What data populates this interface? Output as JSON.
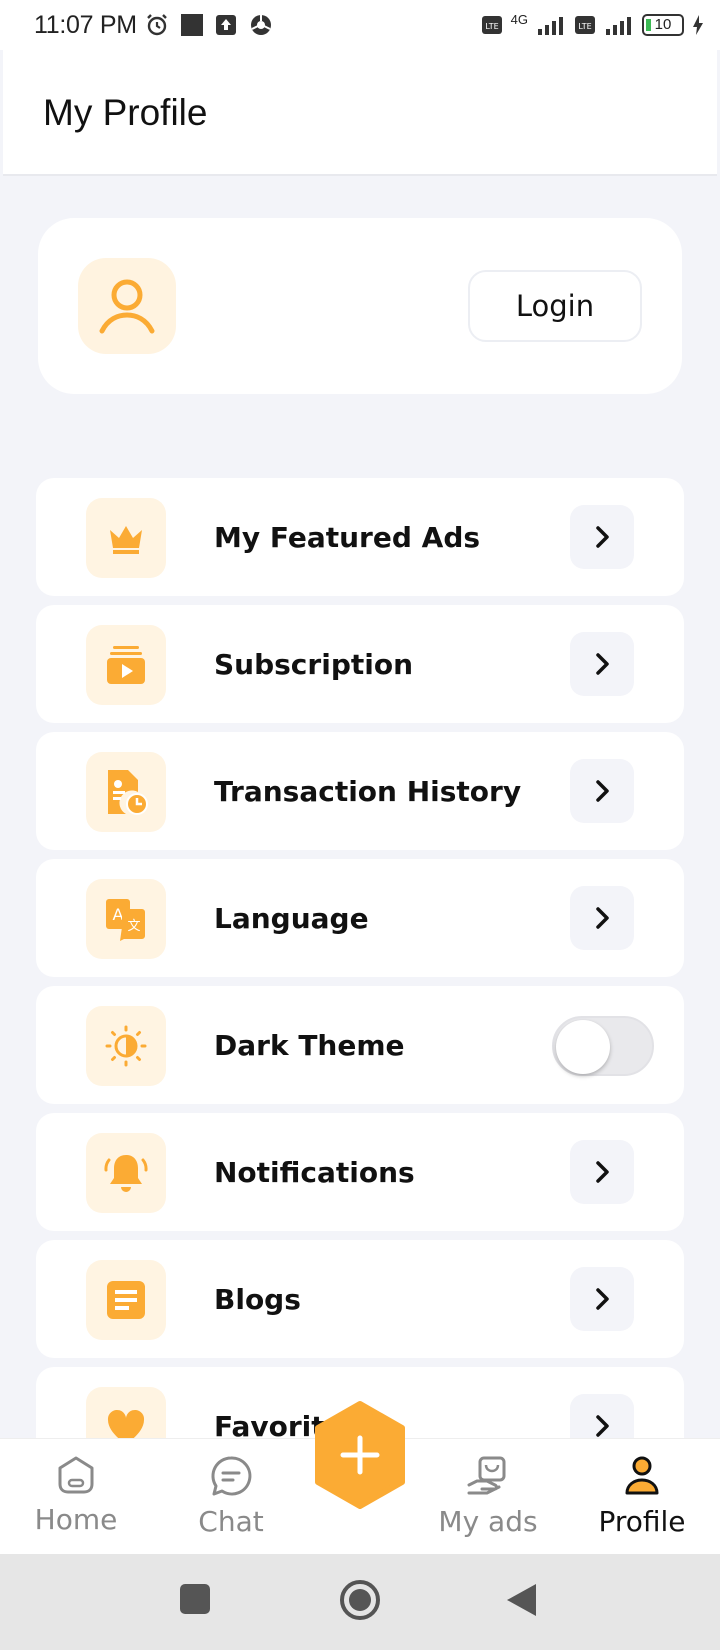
{
  "status_bar": {
    "time": "11:07 PM",
    "network": "4G",
    "battery": "10"
  },
  "header": {
    "title": "My Profile"
  },
  "profile_card": {
    "login_label": "Login"
  },
  "menu": {
    "items": [
      {
        "label": "My Featured Ads",
        "icon": "crown-icon"
      },
      {
        "label": "Subscription",
        "icon": "subscription-icon"
      },
      {
        "label": "Transaction History",
        "icon": "transaction-history-icon"
      },
      {
        "label": "Language",
        "icon": "language-icon"
      },
      {
        "label": "Dark Theme",
        "icon": "theme-icon",
        "toggle_on": false
      },
      {
        "label": "Notifications",
        "icon": "bell-icon"
      },
      {
        "label": "Blogs",
        "icon": "blog-icon"
      },
      {
        "label": "Favorites",
        "icon": "heart-icon"
      }
    ]
  },
  "bottom_nav": {
    "items": [
      {
        "label": "Home",
        "icon": "home-icon"
      },
      {
        "label": "Chat",
        "icon": "chat-icon"
      },
      {
        "label": "My ads",
        "icon": "my-ads-icon"
      },
      {
        "label": "Profile",
        "icon": "profile-icon"
      }
    ],
    "active": "Profile"
  },
  "colors": {
    "accent": "#fbab34",
    "accent_light": "#fff4e2",
    "background": "#f3f4f9"
  }
}
